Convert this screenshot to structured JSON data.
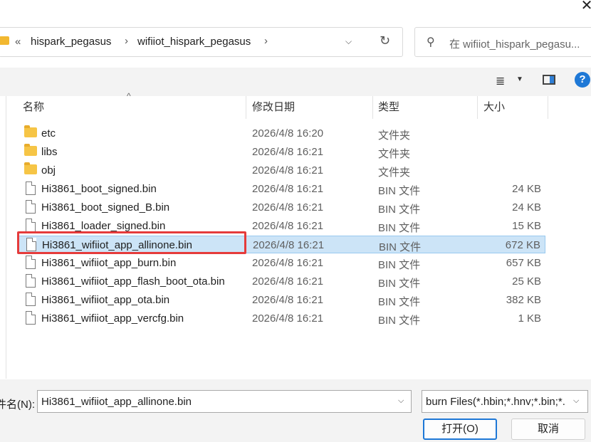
{
  "window": {
    "close_glyph": "✕"
  },
  "address": {
    "back": "«",
    "crumbs": [
      "hispark_pegasus",
      "wifiiot_hispark_pegasus"
    ],
    "sep": "›",
    "dropdown": "⌵",
    "refresh": "↻"
  },
  "search": {
    "placeholder": "在 wifiiot_hispark_pegasu...",
    "icon": "⚲"
  },
  "toolbar": {
    "view_glyph": "≣",
    "view_dd": "▼",
    "help": "?"
  },
  "columns": {
    "name": "名称",
    "date": "修改日期",
    "type": "类型",
    "size": "大小",
    "sort": "^"
  },
  "files": [
    {
      "name": "etc",
      "date": "2026/4/8 16:20",
      "type": "文件夹",
      "size": "",
      "kind": "folder"
    },
    {
      "name": "libs",
      "date": "2026/4/8 16:21",
      "type": "文件夹",
      "size": "",
      "kind": "folder"
    },
    {
      "name": "obj",
      "date": "2026/4/8 16:21",
      "type": "文件夹",
      "size": "",
      "kind": "folder"
    },
    {
      "name": "Hi3861_boot_signed.bin",
      "date": "2026/4/8 16:21",
      "type": "BIN 文件",
      "size": "24 KB",
      "kind": "file"
    },
    {
      "name": "Hi3861_boot_signed_B.bin",
      "date": "2026/4/8 16:21",
      "type": "BIN 文件",
      "size": "24 KB",
      "kind": "file"
    },
    {
      "name": "Hi3861_loader_signed.bin",
      "date": "2026/4/8 16:21",
      "type": "BIN 文件",
      "size": "15 KB",
      "kind": "file"
    },
    {
      "name": "Hi3861_wifiiot_app_allinone.bin",
      "date": "2026/4/8 16:21",
      "type": "BIN 文件",
      "size": "672 KB",
      "kind": "file",
      "selected": true
    },
    {
      "name": "Hi3861_wifiiot_app_burn.bin",
      "date": "2026/4/8 16:21",
      "type": "BIN 文件",
      "size": "657 KB",
      "kind": "file"
    },
    {
      "name": "Hi3861_wifiiot_app_flash_boot_ota.bin",
      "date": "2026/4/8 16:21",
      "type": "BIN 文件",
      "size": "25 KB",
      "kind": "file"
    },
    {
      "name": "Hi3861_wifiiot_app_ota.bin",
      "date": "2026/4/8 16:21",
      "type": "BIN 文件",
      "size": "382 KB",
      "kind": "file"
    },
    {
      "name": "Hi3861_wifiiot_app_vercfg.bin",
      "date": "2026/4/8 16:21",
      "type": "BIN 文件",
      "size": "1 KB",
      "kind": "file"
    }
  ],
  "filename": {
    "label": "件名(N):",
    "value": "Hi3861_wifiiot_app_allinone.bin",
    "dd": "⌵"
  },
  "filetype": {
    "value": "burn Files(*.hbin;*.hnv;*.bin;*.",
    "dd": "⌵"
  },
  "buttons": {
    "open": "打开(O)",
    "cancel": "取消"
  },
  "colors": {
    "selection": "#cce4f7",
    "highlight_box": "#e53b3b",
    "accent": "#1e78d6"
  }
}
